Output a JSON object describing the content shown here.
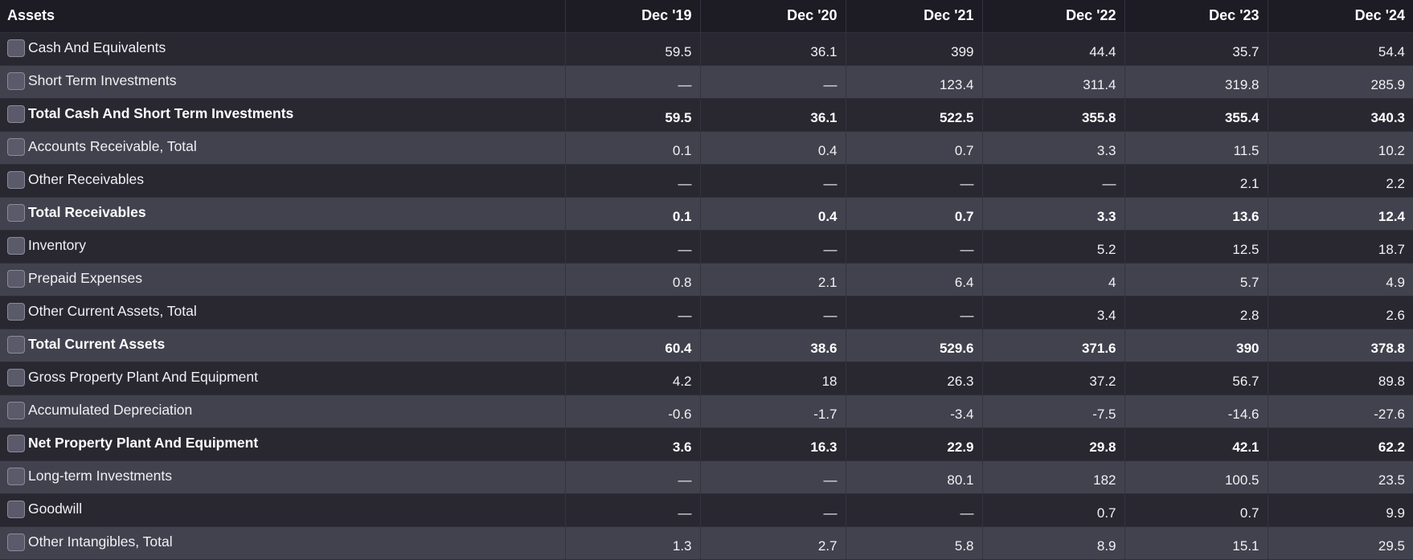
{
  "table": {
    "header": {
      "label": "Assets",
      "periods": [
        "Dec '19",
        "Dec '20",
        "Dec '21",
        "Dec '22",
        "Dec '23",
        "Dec '24"
      ]
    },
    "rows": [
      {
        "label": "Cash And Equivalents",
        "bold": false,
        "values": [
          "59.5",
          "36.1",
          "399",
          "44.4",
          "35.7",
          "54.4"
        ]
      },
      {
        "label": "Short Term Investments",
        "bold": false,
        "values": [
          "—",
          "—",
          "123.4",
          "311.4",
          "319.8",
          "285.9"
        ]
      },
      {
        "label": "Total Cash And Short Term Investments",
        "bold": true,
        "values": [
          "59.5",
          "36.1",
          "522.5",
          "355.8",
          "355.4",
          "340.3"
        ]
      },
      {
        "label": "Accounts Receivable, Total",
        "bold": false,
        "values": [
          "0.1",
          "0.4",
          "0.7",
          "3.3",
          "11.5",
          "10.2"
        ]
      },
      {
        "label": "Other Receivables",
        "bold": false,
        "values": [
          "—",
          "—",
          "—",
          "—",
          "2.1",
          "2.2"
        ]
      },
      {
        "label": "Total Receivables",
        "bold": true,
        "values": [
          "0.1",
          "0.4",
          "0.7",
          "3.3",
          "13.6",
          "12.4"
        ]
      },
      {
        "label": "Inventory",
        "bold": false,
        "values": [
          "—",
          "—",
          "—",
          "5.2",
          "12.5",
          "18.7"
        ]
      },
      {
        "label": "Prepaid Expenses",
        "bold": false,
        "values": [
          "0.8",
          "2.1",
          "6.4",
          "4",
          "5.7",
          "4.9"
        ]
      },
      {
        "label": "Other Current Assets, Total",
        "bold": false,
        "values": [
          "—",
          "—",
          "—",
          "3.4",
          "2.8",
          "2.6"
        ]
      },
      {
        "label": "Total Current Assets",
        "bold": true,
        "values": [
          "60.4",
          "38.6",
          "529.6",
          "371.6",
          "390",
          "378.8"
        ]
      },
      {
        "label": "Gross Property Plant And Equipment",
        "bold": false,
        "values": [
          "4.2",
          "18",
          "26.3",
          "37.2",
          "56.7",
          "89.8"
        ]
      },
      {
        "label": "Accumulated Depreciation",
        "bold": false,
        "values": [
          "-0.6",
          "-1.7",
          "-3.4",
          "-7.5",
          "-14.6",
          "-27.6"
        ]
      },
      {
        "label": "Net Property Plant And Equipment",
        "bold": true,
        "values": [
          "3.6",
          "16.3",
          "22.9",
          "29.8",
          "42.1",
          "62.2"
        ]
      },
      {
        "label": "Long-term Investments",
        "bold": false,
        "values": [
          "—",
          "—",
          "80.1",
          "182",
          "100.5",
          "23.5"
        ]
      },
      {
        "label": "Goodwill",
        "bold": false,
        "values": [
          "—",
          "—",
          "—",
          "0.7",
          "0.7",
          "9.9"
        ]
      },
      {
        "label": "Other Intangibles, Total",
        "bold": false,
        "values": [
          "1.3",
          "2.7",
          "5.8",
          "8.9",
          "15.1",
          "29.5"
        ]
      }
    ]
  }
}
